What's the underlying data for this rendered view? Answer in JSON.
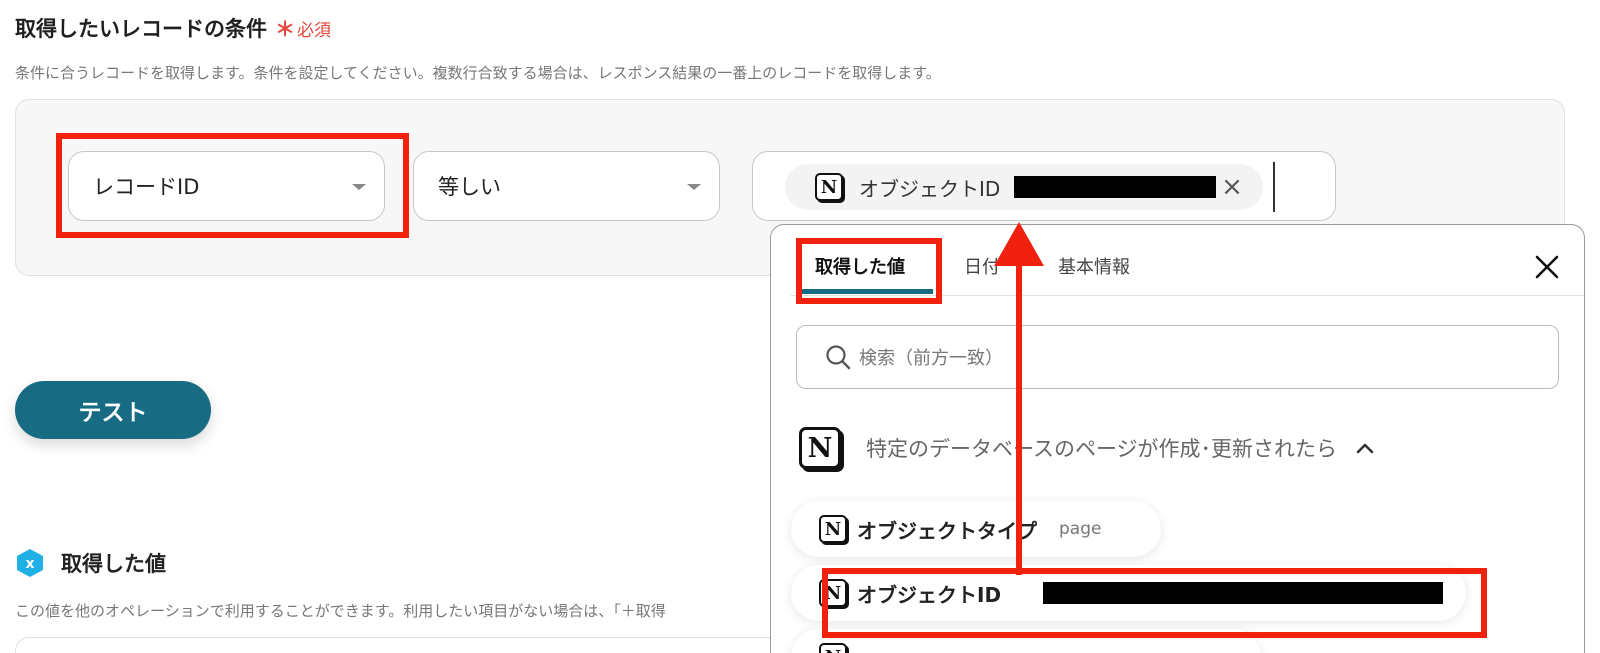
{
  "section": {
    "title": "取得したいレコードの条件",
    "required_star": "＊",
    "required_text": "必須",
    "description": "条件に合うレコードを取得します。条件を設定してください。複数行合致する場合は、レスポンス結果の一番上のレコードを取得します。"
  },
  "condition": {
    "field_value": "レコードID",
    "operator_value": "等しい",
    "chip_label": "オブジェクトID"
  },
  "test_button": "テスト",
  "obtained": {
    "title": "取得した値",
    "description": "この値を他のオペレーションで利用することができます。利用したい項目がない場合は、「＋取得"
  },
  "popup": {
    "tabs": [
      "取得した値",
      "日付",
      "基本情報"
    ],
    "search_placeholder": "検索（前方一致）",
    "source_title": "特定のデータベースのページが作成･更新されたら",
    "items": [
      {
        "label": "オブジェクトタイプ",
        "value": "page"
      },
      {
        "label": "オブジェクトID",
        "value": ""
      }
    ]
  },
  "icons": {
    "notion": "notion-logo-icon",
    "hex": "yoom-hex-icon",
    "search": "search-icon",
    "close": "close-icon",
    "chevron": "chevron-up-icon"
  },
  "colors": {
    "primary": "#176b82",
    "highlight": "#f0220f",
    "required": "#e2463a"
  }
}
